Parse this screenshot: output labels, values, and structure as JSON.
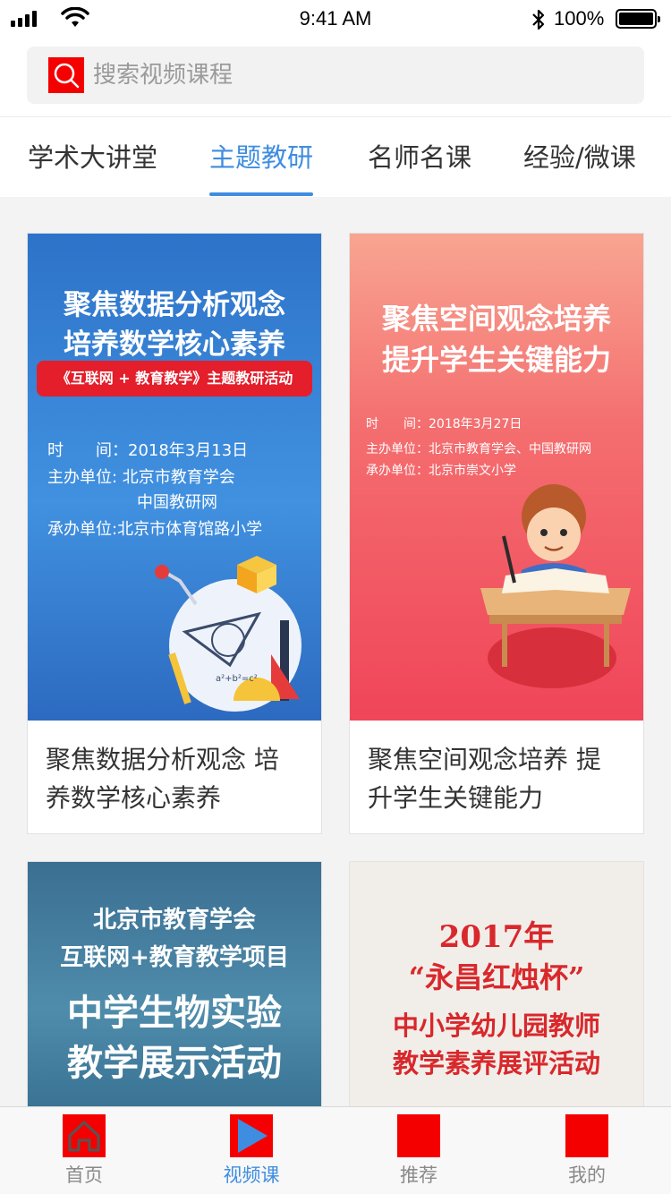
{
  "status_bar": {
    "time": "9:41 AM",
    "battery": "100%"
  },
  "search": {
    "placeholder": "搜索视频课程",
    "icon": "search-icon"
  },
  "tabs": [
    {
      "label": "学术大讲堂",
      "active": false
    },
    {
      "label": "主题教研",
      "active": true
    },
    {
      "label": "名师名课",
      "active": false
    },
    {
      "label": "经验/微课",
      "active": false
    }
  ],
  "cards": [
    {
      "title": "聚焦数据分析观念 培养数学核心素养",
      "cover": {
        "headline_1": "聚焦数据分析观念",
        "headline_2": "培养数学核心素养",
        "banner": "《互联网 + 教育教学》主题教研活动",
        "line_1": "时　　间：2018年3月13日",
        "line_2": "主办单位: 北京市教育学会",
        "line_3": "中国教研网",
        "line_4": "承办单位:北京市体育馆路小学",
        "formula": "a²+b²=c²"
      }
    },
    {
      "title": "聚焦空间观念培养 提升学生关键能力",
      "cover": {
        "headline_1": "聚焦空间观念培养",
        "headline_2": "提升学生关键能力",
        "line_1": "时　　间：2018年3月27日",
        "line_2": "主办单位：北京市教育学会、中国教研网",
        "line_3": "承办单位：北京市崇文小学"
      }
    },
    {
      "cover": {
        "headline_1": "北京市教育学会",
        "headline_2": "互联网+教育教学项目",
        "headline_3": "中学生物实验",
        "headline_4": "教学展示活动"
      }
    },
    {
      "cover": {
        "headline_1": "2017年",
        "headline_2": "“永昌红烛杯”",
        "headline_3": "中小学幼儿园教师",
        "headline_4": "教学素养展评活动"
      }
    }
  ],
  "tabbar": [
    {
      "label": "首页",
      "icon": "home-icon",
      "active": false
    },
    {
      "label": "视频课",
      "icon": "play-icon",
      "active": true
    },
    {
      "label": "推荐",
      "icon": "recommend-icon",
      "active": false
    },
    {
      "label": "我的",
      "icon": "profile-icon",
      "active": false
    }
  ],
  "colors": {
    "accent": "#3e8de0",
    "icon_red": "#f50000"
  }
}
